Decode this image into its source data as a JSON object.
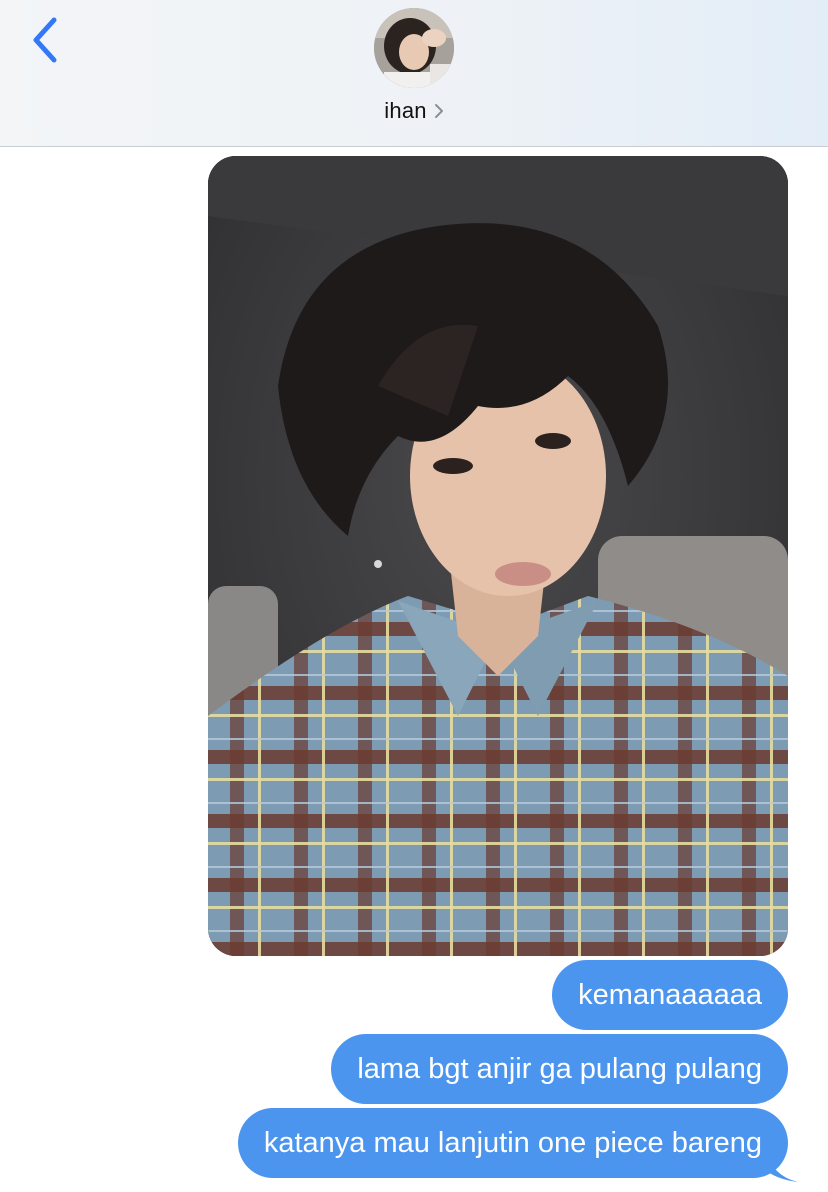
{
  "header": {
    "contact_name": "ihan",
    "back_icon": "chevron-left-icon",
    "chevron_icon": "chevron-right-icon",
    "accent_color": "#3478f6"
  },
  "messages": [
    {
      "type": "image",
      "sender": "me",
      "image_subject": "selfie photo in plaid shirt"
    },
    {
      "type": "text",
      "sender": "me",
      "text": "kemanaaaaaa"
    },
    {
      "type": "text",
      "sender": "me",
      "text": "lama bgt anjir ga pulang pulang"
    },
    {
      "type": "text",
      "sender": "me",
      "text": "katanya mau lanjutin one piece bareng"
    }
  ],
  "colors": {
    "sent_bubble": "#4b95ef",
    "sent_text": "#ffffff",
    "header_bg": "#eef2f6"
  }
}
